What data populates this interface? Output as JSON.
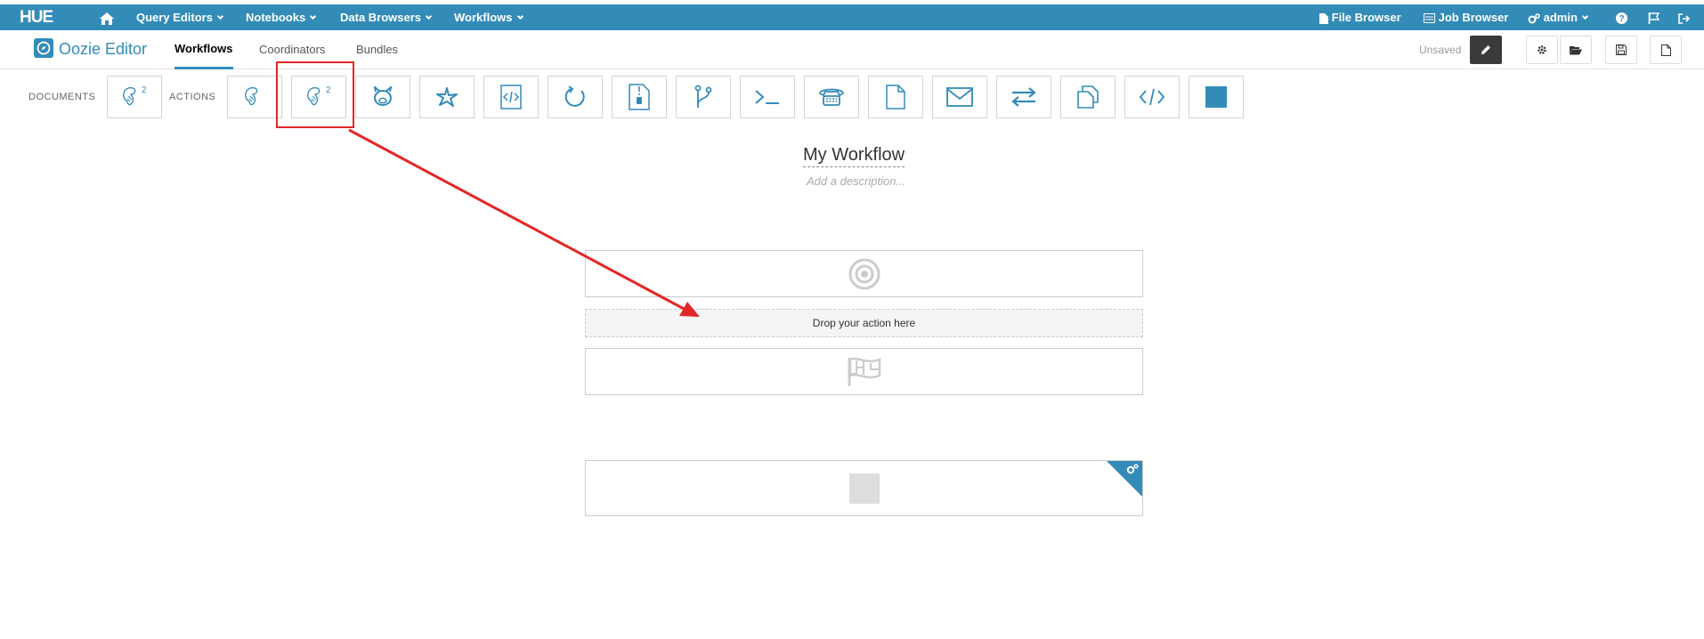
{
  "topbar": {
    "logo": "HUE",
    "home_icon": "home-icon",
    "menus": [
      {
        "label": "Query Editors"
      },
      {
        "label": "Notebooks"
      },
      {
        "label": "Data Browsers"
      },
      {
        "label": "Workflows"
      }
    ],
    "right": {
      "file_browser": "File Browser",
      "job_browser": "Job Browser",
      "user": "admin"
    }
  },
  "subbar": {
    "title": "Oozie Editor",
    "tabs": [
      {
        "label": "Workflows",
        "active": true
      },
      {
        "label": "Coordinators",
        "active": false
      },
      {
        "label": "Bundles",
        "active": false
      }
    ],
    "status": "Unsaved"
  },
  "palette": {
    "documents_label": "DOCUMENTS",
    "actions_label": "ACTIONS",
    "documents": [
      {
        "icon": "hive2-icon"
      }
    ],
    "actions": [
      {
        "icon": "hive-icon"
      },
      {
        "icon": "hive2-icon"
      },
      {
        "icon": "pig-icon"
      },
      {
        "icon": "spark-icon"
      },
      {
        "icon": "java-icon"
      },
      {
        "icon": "subworkflow-icon"
      },
      {
        "icon": "mapreduce-icon"
      },
      {
        "icon": "fork-icon"
      },
      {
        "icon": "shell-icon"
      },
      {
        "icon": "ssh-icon"
      },
      {
        "icon": "hdfs-fs-icon"
      },
      {
        "icon": "email-icon"
      },
      {
        "icon": "streaming-icon"
      },
      {
        "icon": "distcp-icon"
      },
      {
        "icon": "generic-xml-icon"
      },
      {
        "icon": "kill-icon"
      }
    ]
  },
  "workflow": {
    "name": "My Workflow",
    "description_placeholder": "Add a description...",
    "drop_text": "Drop your action here"
  },
  "colors": {
    "brand": "#338bb8",
    "annotation": "#e22727"
  }
}
